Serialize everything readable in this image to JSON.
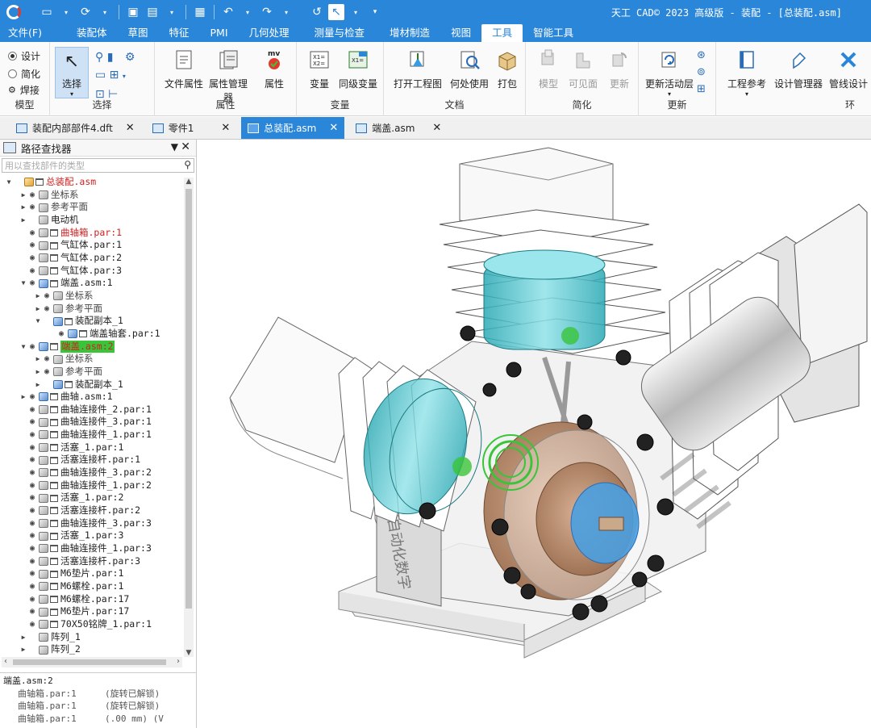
{
  "title_bar": {
    "title": "天工 CAD© 2023 高级版 - 装配 - [总装配.asm]",
    "quick_access": [
      "new-icon",
      "open-icon",
      "save-icon",
      "undo-icon",
      "redo-icon",
      "select-icon"
    ]
  },
  "menu": {
    "items": [
      "文件(F)",
      "装配体",
      "草图",
      "特征",
      "PMI",
      "几何处理",
      "测量与检查",
      "增材制造",
      "视图",
      "工具",
      "智能工具"
    ],
    "active": "工具"
  },
  "ribbon": {
    "model": {
      "options": [
        "设计",
        "简化",
        "焊接"
      ],
      "label": "模型"
    },
    "select": {
      "button": "选择",
      "label": "选择"
    },
    "properties": {
      "buttons": [
        "文件属性",
        "属性管理器",
        "属性"
      ],
      "label": "属性"
    },
    "variables": {
      "buttons": [
        "变量",
        "同级变量"
      ],
      "label": "变量"
    },
    "document": {
      "buttons": [
        "打开工程图",
        "何处使用",
        "打包"
      ],
      "label": "文档"
    },
    "simplify": {
      "buttons": [
        "模型",
        "可见面",
        "更新"
      ],
      "label": "简化"
    },
    "update": {
      "button": "更新活动层",
      "label": "更新"
    },
    "env": {
      "buttons": [
        "工程参考",
        "设计管理器",
        "管线设计"
      ],
      "label": "环"
    }
  },
  "tabs": [
    {
      "label": "装配内部部件4.dft",
      "active": false
    },
    {
      "label": "零件1",
      "active": false
    },
    {
      "label": "总装配.asm",
      "active": true
    },
    {
      "label": "端盖.asm",
      "active": false
    }
  ],
  "pathfinder": {
    "title": "路径查找器",
    "search_placeholder": "用以查找部件的类型",
    "tree": [
      {
        "label": "总装配.asm",
        "level": 0,
        "arrow": "▼",
        "eye": false,
        "icon": "top",
        "style": "red"
      },
      {
        "label": "坐标系",
        "level": 1,
        "arrow": "▶",
        "eye": true,
        "icon": "coord",
        "style": "gray"
      },
      {
        "label": "参考平面",
        "level": 1,
        "arrow": "▶",
        "eye": true,
        "icon": "plane",
        "style": "gray"
      },
      {
        "label": "电动机",
        "level": 1,
        "arrow": "▶",
        "eye": false,
        "icon": "folder",
        "style": ""
      },
      {
        "label": "曲轴箱.par:1",
        "level": 1,
        "arrow": "",
        "eye": true,
        "icon": "part",
        "style": "red"
      },
      {
        "label": "气缸体.par:1",
        "level": 1,
        "arrow": "",
        "eye": true,
        "icon": "part",
        "style": ""
      },
      {
        "label": "气缸体.par:2",
        "level": 1,
        "arrow": "",
        "eye": true,
        "icon": "part",
        "style": ""
      },
      {
        "label": "气缸体.par:3",
        "level": 1,
        "arrow": "",
        "eye": true,
        "icon": "part",
        "style": ""
      },
      {
        "label": "端盖.asm:1",
        "level": 1,
        "arrow": "▼",
        "eye": true,
        "icon": "asm",
        "style": ""
      },
      {
        "label": "坐标系",
        "level": 2,
        "arrow": "▶",
        "eye": true,
        "icon": "coord",
        "style": "gray"
      },
      {
        "label": "参考平面",
        "level": 2,
        "arrow": "▶",
        "eye": true,
        "icon": "plane",
        "style": "gray"
      },
      {
        "label": "装配副本_1",
        "level": 2,
        "arrow": "▼",
        "eye": false,
        "icon": "asm",
        "style": ""
      },
      {
        "label": "端盖轴套.par:1",
        "level": 3,
        "arrow": "",
        "eye": true,
        "icon": "asm",
        "style": ""
      },
      {
        "label": "端盖.asm:2",
        "level": 1,
        "arrow": "▼",
        "eye": true,
        "icon": "asm",
        "style": "hl"
      },
      {
        "label": "坐标系",
        "level": 2,
        "arrow": "▶",
        "eye": true,
        "icon": "coord",
        "style": "gray"
      },
      {
        "label": "参考平面",
        "level": 2,
        "arrow": "▶",
        "eye": true,
        "icon": "plane",
        "style": "gray"
      },
      {
        "label": "装配副本_1",
        "level": 2,
        "arrow": "▶",
        "eye": false,
        "icon": "asm",
        "style": ""
      },
      {
        "label": "曲轴.asm:1",
        "level": 1,
        "arrow": "▶",
        "eye": true,
        "icon": "asm",
        "style": ""
      },
      {
        "label": "曲轴连接件_2.par:1",
        "level": 1,
        "arrow": "",
        "eye": true,
        "icon": "part",
        "style": ""
      },
      {
        "label": "曲轴连接件_3.par:1",
        "level": 1,
        "arrow": "",
        "eye": true,
        "icon": "part",
        "style": ""
      },
      {
        "label": "曲轴连接件_1.par:1",
        "level": 1,
        "arrow": "",
        "eye": true,
        "icon": "part",
        "style": ""
      },
      {
        "label": "活塞_1.par:1",
        "level": 1,
        "arrow": "",
        "eye": true,
        "icon": "part",
        "style": ""
      },
      {
        "label": "活塞连接杆.par:1",
        "level": 1,
        "arrow": "",
        "eye": true,
        "icon": "part",
        "style": ""
      },
      {
        "label": "曲轴连接件_3.par:2",
        "level": 1,
        "arrow": "",
        "eye": true,
        "icon": "part",
        "style": ""
      },
      {
        "label": "曲轴连接件_1.par:2",
        "level": 1,
        "arrow": "",
        "eye": true,
        "icon": "part",
        "style": ""
      },
      {
        "label": "活塞_1.par:2",
        "level": 1,
        "arrow": "",
        "eye": true,
        "icon": "part",
        "style": ""
      },
      {
        "label": "活塞连接杆.par:2",
        "level": 1,
        "arrow": "",
        "eye": true,
        "icon": "part",
        "style": ""
      },
      {
        "label": "曲轴连接件_3.par:3",
        "level": 1,
        "arrow": "",
        "eye": true,
        "icon": "part",
        "style": ""
      },
      {
        "label": "活塞_1.par:3",
        "level": 1,
        "arrow": "",
        "eye": true,
        "icon": "part",
        "style": ""
      },
      {
        "label": "曲轴连接件_1.par:3",
        "level": 1,
        "arrow": "",
        "eye": true,
        "icon": "part",
        "style": ""
      },
      {
        "label": "活塞连接杆.par:3",
        "level": 1,
        "arrow": "",
        "eye": true,
        "icon": "part",
        "style": ""
      },
      {
        "label": "M6垫片.par:1",
        "level": 1,
        "arrow": "",
        "eye": true,
        "icon": "part",
        "style": ""
      },
      {
        "label": "M6螺栓.par:1",
        "level": 1,
        "arrow": "",
        "eye": true,
        "icon": "part",
        "style": ""
      },
      {
        "label": "M6螺栓.par:17",
        "level": 1,
        "arrow": "",
        "eye": true,
        "icon": "part",
        "style": ""
      },
      {
        "label": "M6垫片.par:17",
        "level": 1,
        "arrow": "",
        "eye": true,
        "icon": "part",
        "style": ""
      },
      {
        "label": "70X50铭牌_1.par:1",
        "level": 1,
        "arrow": "",
        "eye": true,
        "icon": "part",
        "style": ""
      },
      {
        "label": "阵列_1",
        "level": 1,
        "arrow": "▶",
        "eye": false,
        "icon": "pattern",
        "style": ""
      },
      {
        "label": "阵列_2",
        "level": 1,
        "arrow": "▶",
        "eye": false,
        "icon": "pattern",
        "style": ""
      }
    ],
    "relations": {
      "header": "端盖.asm:2",
      "rows": [
        {
          "name": "曲轴箱.par:1",
          "detail": "(旋转已解锁)"
        },
        {
          "name": "曲轴箱.par:1",
          "detail": "(旋转已解锁)"
        },
        {
          "name": "曲轴箱.par:1",
          "detail": "(.00 mm)   (V"
        }
      ]
    }
  },
  "viewport": {
    "nameplate_text": "自动化数字"
  },
  "colors": {
    "accent": "#2a86d8",
    "cylinder_cyan": "#4fc8d0",
    "flywheel_bronze": "#b98a68",
    "hub_blue": "#4a9ee0",
    "highlight_green": "#3ac43a"
  }
}
